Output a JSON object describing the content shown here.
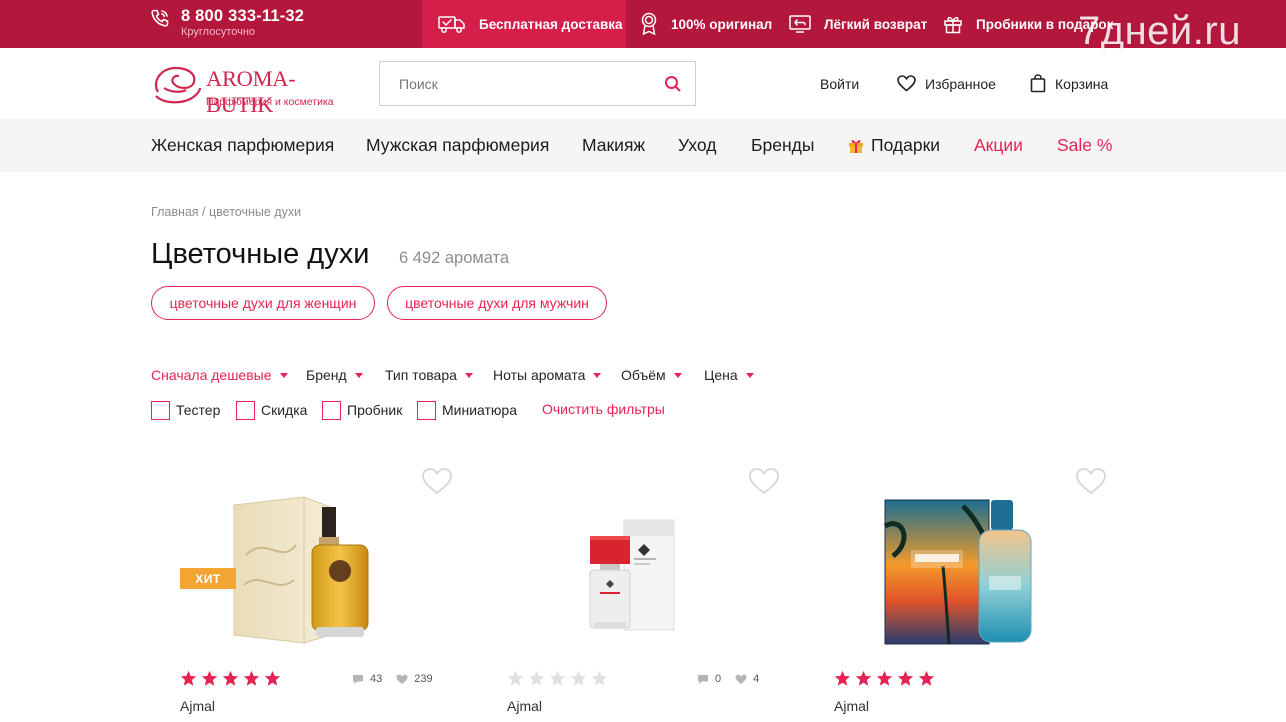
{
  "topbar": {
    "phone": "8 800 333-11-32",
    "phone_note": "Круглосуточно",
    "perks": [
      {
        "label": "Бесплатная доставка",
        "icon": "delivery-truck-icon"
      },
      {
        "label": "100% оригинал",
        "icon": "award-medal-icon"
      },
      {
        "label": "Лёгкий возврат",
        "icon": "return-monitor-icon"
      },
      {
        "label": "Пробники в подарок",
        "icon": "gift-icon"
      }
    ],
    "watermark": "7дней.ru",
    "colors": {
      "bar": "#b3173c",
      "highlight": "#d51f4a"
    }
  },
  "header": {
    "logo_name": "AROMA-BUTIK",
    "logo_tagline": "Парфюмерия и косметика",
    "search_placeholder": "Поиск",
    "login": "Войти",
    "favorites": "Избранное",
    "cart": "Корзина"
  },
  "nav": {
    "items": [
      {
        "label": "Женская парфюмерия"
      },
      {
        "label": "Мужская парфюмерия"
      },
      {
        "label": "Макияж"
      },
      {
        "label": "Уход"
      },
      {
        "label": "Бренды"
      },
      {
        "label": "Подарки",
        "icon": "gift-icon"
      },
      {
        "label": "Акции",
        "accent": true
      },
      {
        "label": "Sale %",
        "accent": true
      }
    ],
    "accent_color": "#e62453"
  },
  "page": {
    "breadcrumb": "Главная / цветочные духи",
    "title": "Цветочные духи",
    "count": "6 492 аромата",
    "chips": [
      "цветочные духи для женщин",
      "цветочные духи для мужчин"
    ]
  },
  "filters": {
    "sort": "Сначала дешевые",
    "dropdowns": [
      "Бренд",
      "Тип товара",
      "Ноты аромата",
      "Объём",
      "Цена"
    ],
    "checkboxes": [
      "Тестер",
      "Скидка",
      "Пробник",
      "Миниатюра"
    ],
    "clear": "Очистить фильтры"
  },
  "products": [
    {
      "brand": "Ajmal",
      "badge": "ХИТ",
      "rating": 5,
      "comments": "43",
      "likes": "239"
    },
    {
      "brand": "Ajmal",
      "rating": 0,
      "comments": "0",
      "likes": "4"
    },
    {
      "brand": "Ajmal",
      "rating": 5
    }
  ]
}
